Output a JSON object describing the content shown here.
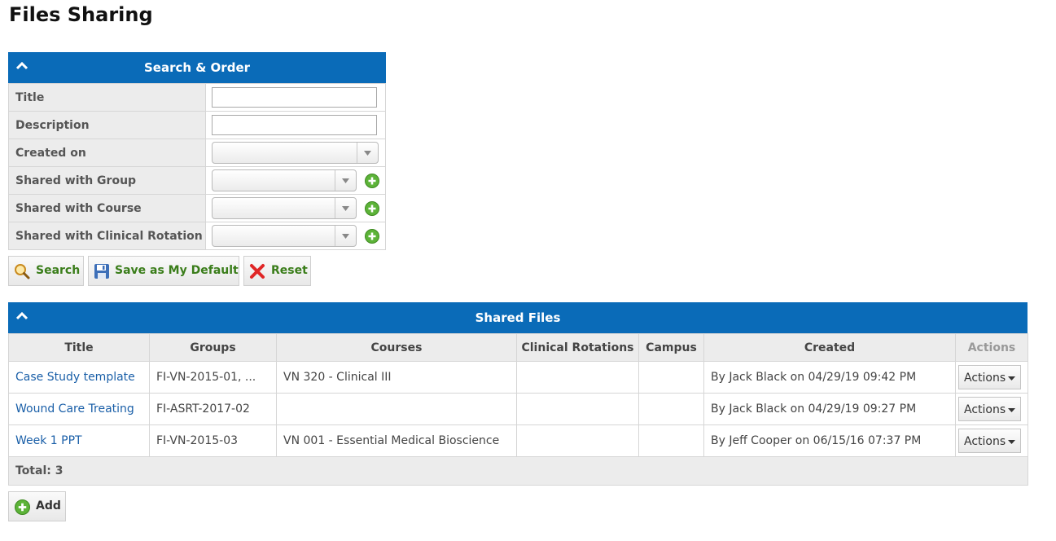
{
  "page": {
    "title": "Files Sharing"
  },
  "search_panel": {
    "header": "Search & Order",
    "fields": [
      {
        "label": "Title",
        "type": "text",
        "value": ""
      },
      {
        "label": "Description",
        "type": "text",
        "value": ""
      },
      {
        "label": "Created on",
        "type": "select",
        "value": ""
      },
      {
        "label": "Shared with Group",
        "type": "select-add",
        "value": ""
      },
      {
        "label": "Shared with Course",
        "type": "select-add",
        "value": ""
      },
      {
        "label": "Shared with Clinical Rotation",
        "type": "select-add",
        "value": ""
      }
    ],
    "buttons": {
      "search": "Search",
      "save_default": "Save as My Default",
      "reset": "Reset"
    }
  },
  "files_panel": {
    "header": "Shared Files",
    "columns": [
      "Title",
      "Groups",
      "Courses",
      "Clinical Rotations",
      "Campus",
      "Created",
      "Actions"
    ],
    "rows": [
      {
        "title": "Case Study template",
        "groups": "FI-VN-2015-01, ...",
        "courses": "VN 320 - Clinical III",
        "clinical_rotations": "",
        "campus": "",
        "created": "By Jack Black on 04/29/19 09:42 PM",
        "action": "Actions"
      },
      {
        "title": "Wound Care Treating",
        "groups": "FI-ASRT-2017-02",
        "courses": "",
        "clinical_rotations": "",
        "campus": "",
        "created": "By Jack Black on 04/29/19 09:27 PM",
        "action": "Actions"
      },
      {
        "title": "Week 1 PPT",
        "groups": "FI-VN-2015-03",
        "courses": "VN 001 - Essential Medical Bioscience",
        "clinical_rotations": "",
        "campus": "",
        "created": "By Jeff Cooper on 06/15/16 07:37 PM",
        "action": "Actions"
      }
    ],
    "total": "Total: 3"
  },
  "add_button": {
    "label": "Add"
  },
  "colors": {
    "header_blue": "#0a6bb8",
    "link_blue": "#1a5fa8",
    "button_green_text": "#3a7d1a",
    "row_gray": "#ececec"
  }
}
